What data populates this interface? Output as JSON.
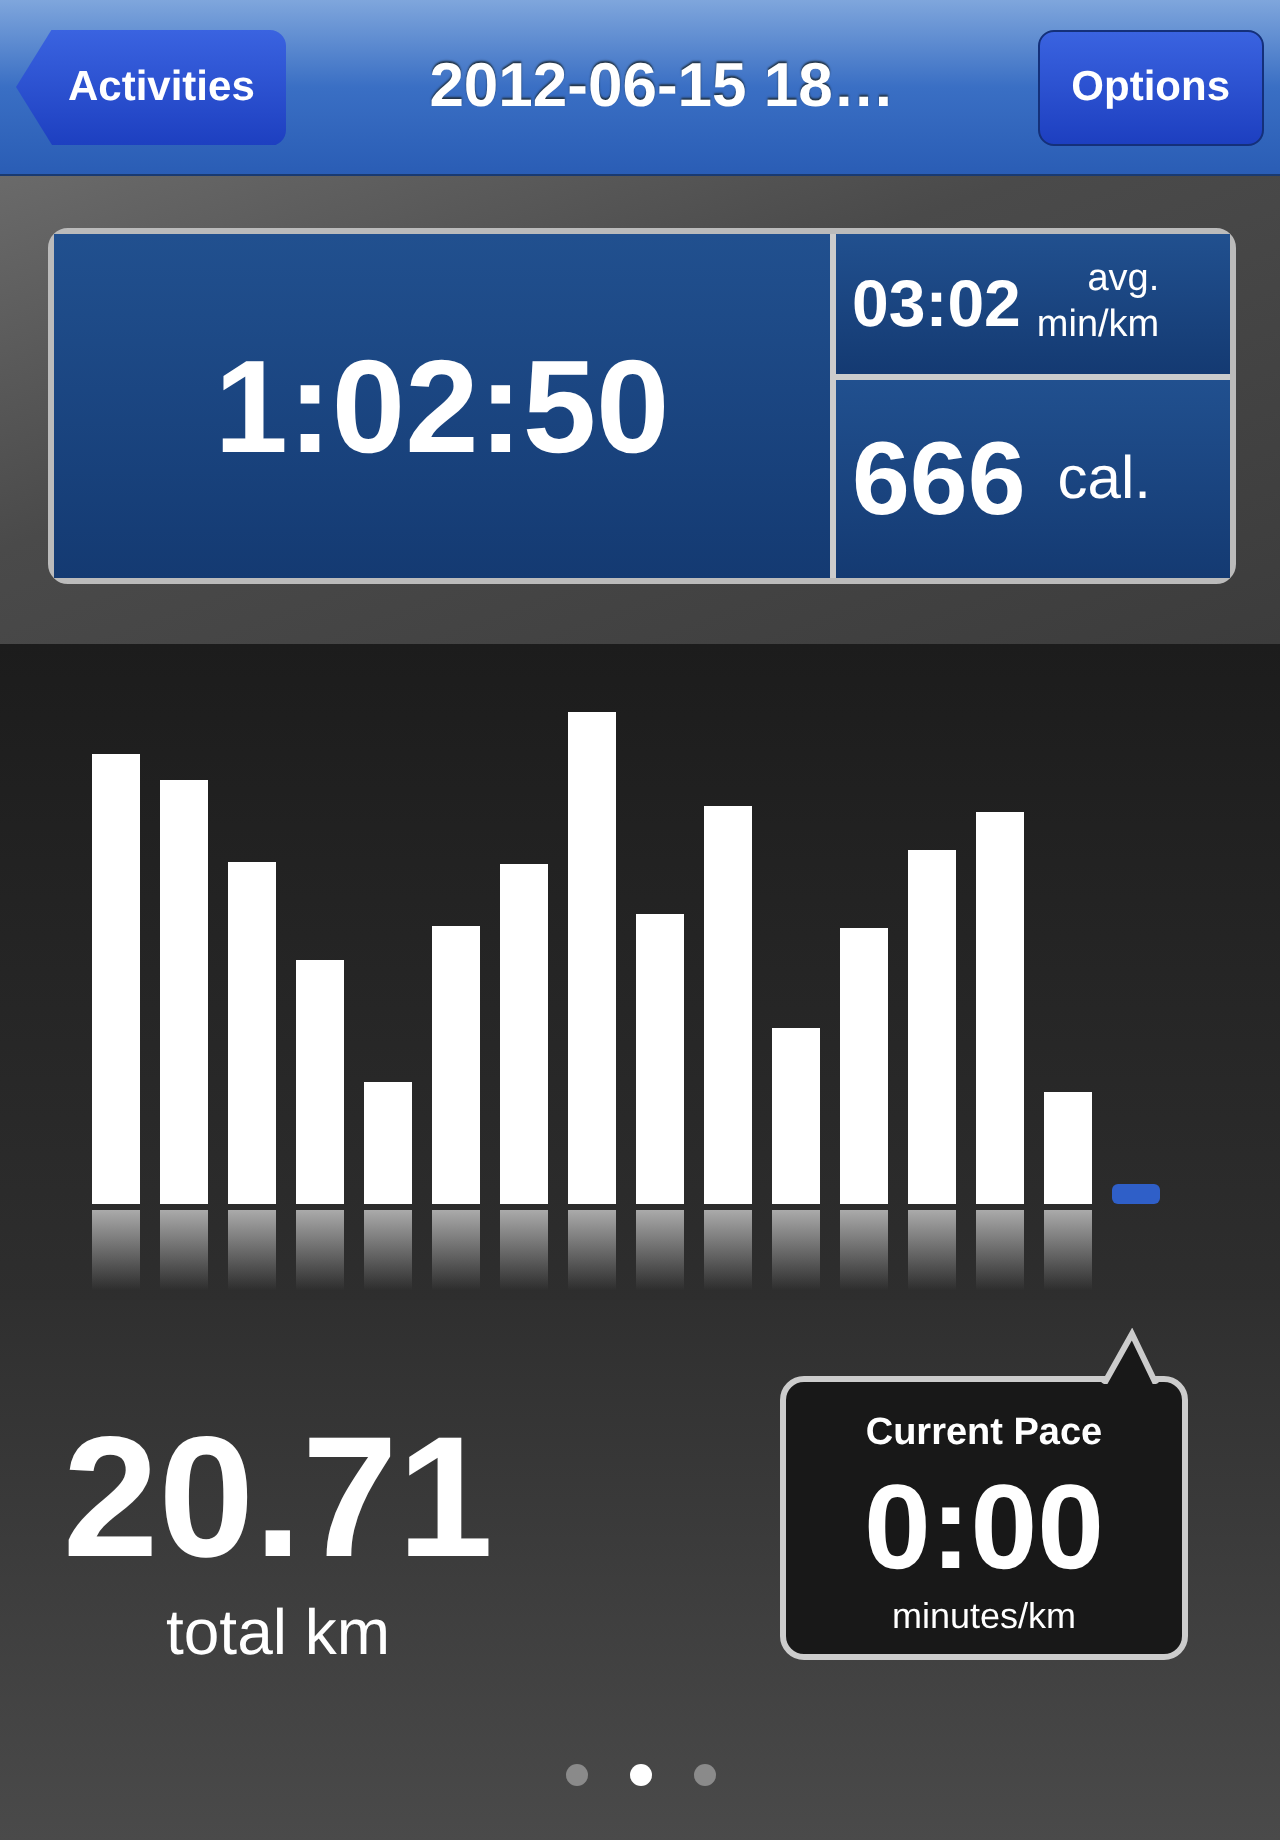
{
  "nav": {
    "back": "Activities",
    "title": "2012-06-15 18…",
    "options": "Options"
  },
  "summary": {
    "duration": "1:02:50",
    "pace": "03:02",
    "pace_unit_top": "avg.",
    "pace_unit_bottom": "min/km",
    "calories": "666",
    "calories_unit": "cal."
  },
  "distance": {
    "value": "20.71",
    "label": "total km"
  },
  "current_pace": {
    "title": "Current Pace",
    "value": "0:00",
    "unit": "minutes/km"
  },
  "pages": [
    {
      "selected": false
    },
    {
      "selected": true
    },
    {
      "selected": false
    }
  ]
}
